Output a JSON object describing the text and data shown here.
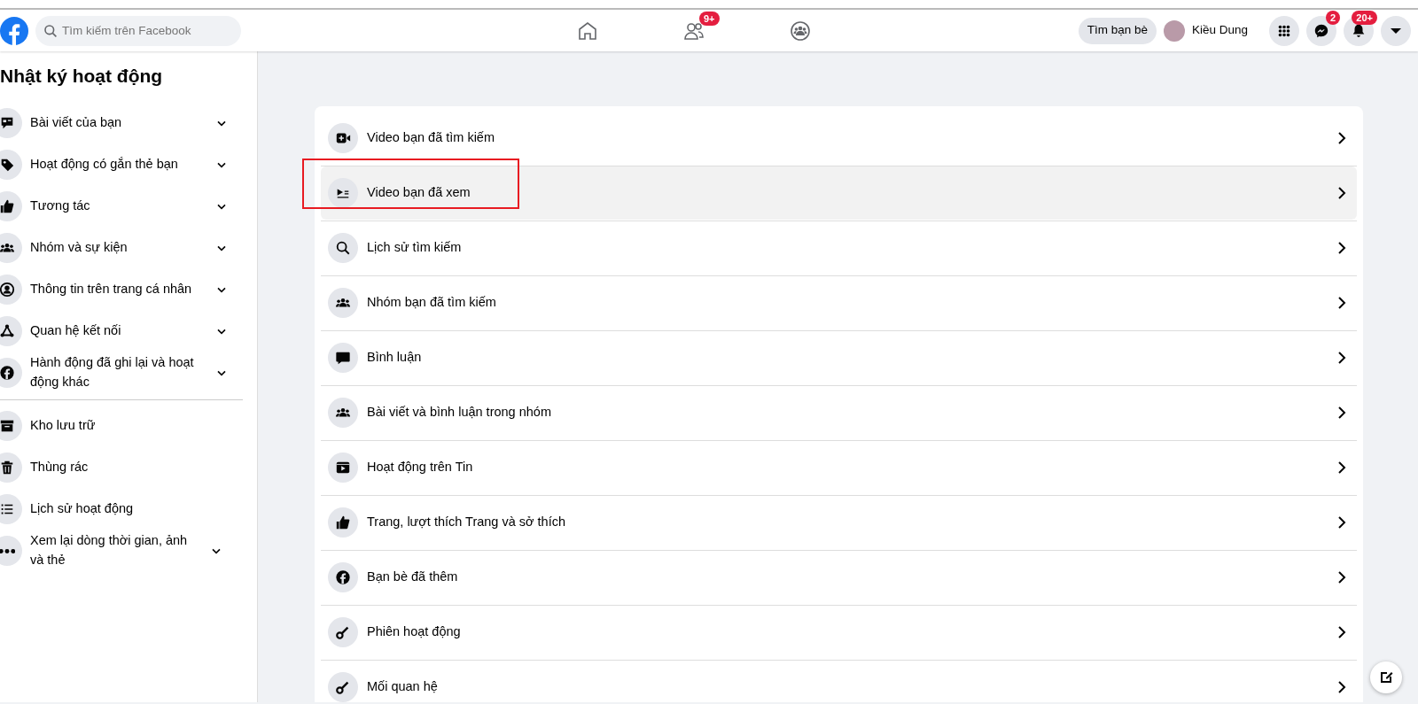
{
  "header": {
    "search": {
      "placeholder": "Tìm kiếm trên Facebook"
    },
    "nav": [
      {
        "selected": false
      },
      {
        "badge": "9+",
        "selected": false
      },
      {
        "selected": false
      }
    ],
    "find_friends": "Tìm bạn bè",
    "profile_name": "Kiều Dung",
    "messenger_badge": "2",
    "notifications_badge": "20+"
  },
  "sidebar": {
    "title": "Nhật ký hoạt động",
    "items": [
      {
        "label": "Bài viết của bạn",
        "kind": "group"
      },
      {
        "label": "Hoạt động có gắn thẻ bạn",
        "kind": "group"
      },
      {
        "label": "Tương tác",
        "kind": "group"
      },
      {
        "label": "Nhóm và sự kiện",
        "kind": "group"
      },
      {
        "label": "Thông tin trên trang cá nhân",
        "kind": "group"
      },
      {
        "label": "Quan hệ kết nối",
        "kind": "group"
      },
      {
        "label": "Hành động đã ghi lại và hoạt động khác",
        "kind": "group"
      },
      {
        "label": "Kho lưu trữ",
        "kind": "link"
      },
      {
        "label": "Thùng rác",
        "kind": "link"
      },
      {
        "label": "Lịch sử hoạt động",
        "kind": "link"
      },
      {
        "label": "Xem lại dòng thời gian, ảnh và thẻ",
        "kind": "group"
      }
    ]
  },
  "categories": [
    {
      "label": "Video bạn đã tìm kiếm",
      "selected": false,
      "marked": false
    },
    {
      "label": "Video bạn đã xem",
      "selected": true,
      "marked": true
    },
    {
      "label": "Lịch sử tìm kiếm",
      "selected": false,
      "marked": false
    },
    {
      "label": "Nhóm bạn đã tìm kiếm",
      "selected": false,
      "marked": false
    },
    {
      "label": "Bình luận",
      "selected": false,
      "marked": false
    },
    {
      "label": "Bài viết và bình luận trong nhóm",
      "selected": false,
      "marked": false
    },
    {
      "label": "Hoạt động trên Tin",
      "selected": false,
      "marked": false
    },
    {
      "label": "Trang, lượt thích Trang và sở thích",
      "selected": false,
      "marked": false
    },
    {
      "label": "Bạn bè đã thêm",
      "selected": false,
      "marked": false
    },
    {
      "label": "Phiên hoạt động",
      "selected": false,
      "marked": false
    },
    {
      "label": "Mối quan hệ",
      "selected": false,
      "marked": false
    }
  ]
}
